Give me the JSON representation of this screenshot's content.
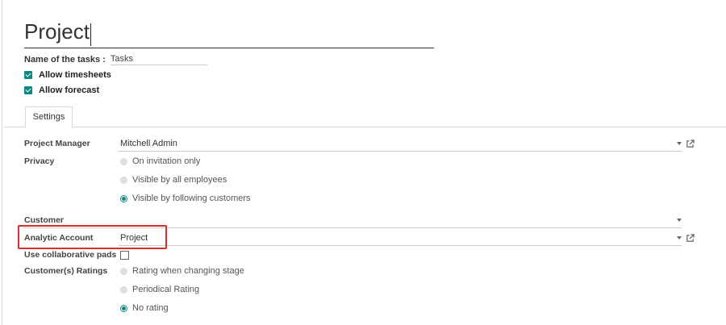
{
  "form": {
    "title": "Project",
    "tasks_label": "Name of the tasks :",
    "tasks_value": "Tasks",
    "allow_timesheets_label": "Allow timesheets",
    "allow_forecast_label": "Allow forecast"
  },
  "tabs": [
    {
      "label": "Settings"
    }
  ],
  "fields": {
    "project_manager": {
      "label": "Project Manager",
      "value": "Mitchell Admin"
    },
    "privacy": {
      "label": "Privacy",
      "options": [
        "On invitation only",
        "Visible by all employees",
        "Visible by following customers"
      ],
      "selected": "Visible by following customers"
    },
    "customer": {
      "label": "Customer",
      "value": ""
    },
    "analytic_account": {
      "label": "Analytic Account",
      "value": "Project"
    },
    "collab_pads": {
      "label": "Use collaborative pads",
      "checked": false
    },
    "ratings": {
      "label": "Customer(s) Ratings",
      "options": [
        "Rating when changing stage",
        "Periodical Rating",
        "No rating"
      ],
      "selected": "No rating"
    }
  },
  "colors": {
    "accent": "#0b8a83",
    "highlight": "#d63031"
  },
  "icons": [
    "dropdown-arrow-icon",
    "external-link-icon",
    "checkbox-checked-icon",
    "radio-icon"
  ]
}
